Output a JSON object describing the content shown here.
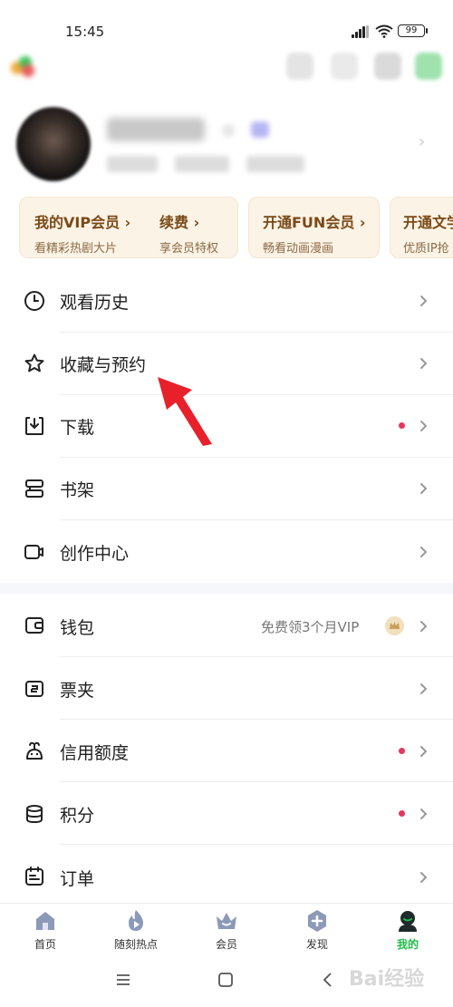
{
  "status_bar": {
    "time": "15:45",
    "battery": "99"
  },
  "cards": [
    {
      "title": "我的VIP会员",
      "sub": "看精彩热剧大片"
    },
    {
      "title": "续费",
      "sub": "享会员特权"
    },
    {
      "title": "开通FUN会员",
      "sub": "畅看动画漫画"
    },
    {
      "title": "开通文学",
      "sub": "优质IP抢"
    }
  ],
  "menu_group_1": [
    {
      "label": "观看历史",
      "icon": "clock-icon",
      "dot": false
    },
    {
      "label": "收藏与预约",
      "icon": "star-icon",
      "dot": false
    },
    {
      "label": "下载",
      "icon": "download-icon",
      "dot": true
    },
    {
      "label": "书架",
      "icon": "bookshelf-icon",
      "dot": false
    },
    {
      "label": "创作中心",
      "icon": "camera-icon",
      "dot": false
    }
  ],
  "menu_group_2": [
    {
      "label": "钱包",
      "icon": "wallet-icon",
      "promo": "免费领3个月VIP",
      "dot": false
    },
    {
      "label": "票夹",
      "icon": "ticket-icon",
      "dot": false
    },
    {
      "label": "信用额度",
      "icon": "credit-icon",
      "dot": true
    },
    {
      "label": "积分",
      "icon": "coins-icon",
      "dot": true
    },
    {
      "label": "订单",
      "icon": "order-icon",
      "dot": false
    }
  ],
  "bottom_nav": [
    {
      "label": "首页",
      "icon": "home-icon",
      "active": false
    },
    {
      "label": "随刻热点",
      "icon": "flame-play-icon",
      "active": false
    },
    {
      "label": "会员",
      "icon": "crown-icon",
      "active": false
    },
    {
      "label": "发现",
      "icon": "discover-icon",
      "active": false
    },
    {
      "label": "我的",
      "icon": "profile-icon",
      "active": true
    }
  ],
  "watermark": "Bai经验",
  "colors": {
    "accent_green": "#1ebd48",
    "dot_red": "#e8365d",
    "card_bg": "#fbf3e6",
    "card_title": "#7a4a17",
    "arrow_red": "#e8202a"
  }
}
